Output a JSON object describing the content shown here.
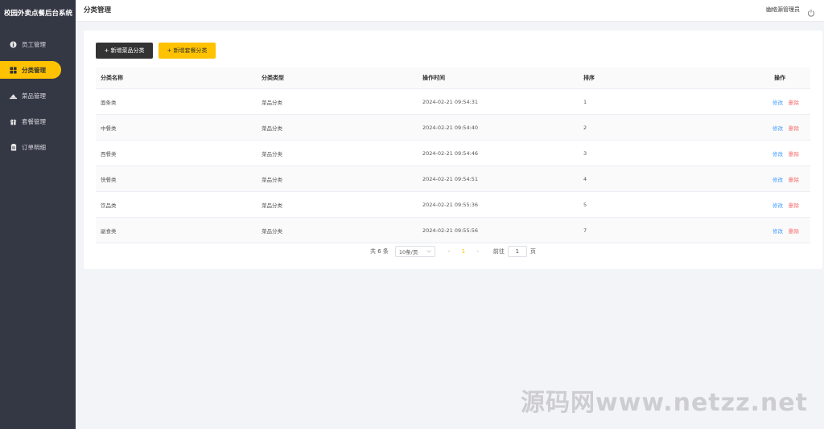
{
  "sidebar": {
    "title": "校园外卖点餐后台系统",
    "items": [
      {
        "label": "员工管理",
        "icon": "info-circle-icon"
      },
      {
        "label": "分类管理",
        "icon": "grid-icon"
      },
      {
        "label": "菜品管理",
        "icon": "dish-icon"
      },
      {
        "label": "套餐管理",
        "icon": "gift-icon"
      },
      {
        "label": "订单明细",
        "icon": "clipboard-icon"
      }
    ],
    "active_index": 1
  },
  "header": {
    "title": "分类管理",
    "user": "幽络源管理员",
    "logout_icon": "power-icon"
  },
  "toolbar": {
    "add_dish_category": "+ 新增菜品分类",
    "add_combo_category": "+ 新增套餐分类"
  },
  "table": {
    "columns": [
      "分类名称",
      "分类类型",
      "操作时间",
      "排序",
      "操作"
    ],
    "rows": [
      {
        "name": "面条类",
        "type": "菜品分类",
        "time": "2024-02-21 09:54:31",
        "sort": "1"
      },
      {
        "name": "中餐类",
        "type": "菜品分类",
        "time": "2024-02-21 09:54:40",
        "sort": "2"
      },
      {
        "name": "西餐类",
        "type": "菜品分类",
        "time": "2024-02-21 09:54:46",
        "sort": "3"
      },
      {
        "name": "快餐类",
        "type": "菜品分类",
        "time": "2024-02-21 09:54:51",
        "sort": "4"
      },
      {
        "name": "饮品类",
        "type": "菜品分类",
        "time": "2024-02-21 09:55:36",
        "sort": "5"
      },
      {
        "name": "副食类",
        "type": "菜品分类",
        "time": "2024-02-21 09:55:56",
        "sort": "7"
      }
    ],
    "edit_label": "修改",
    "delete_label": "删除"
  },
  "pagination": {
    "total": "共 6 条",
    "page_size": "10条/页",
    "current_page": "1",
    "goto_label": "前往",
    "goto_value": "1",
    "page_suffix": "页"
  },
  "watermark": "源码网www.netzz.net",
  "colors": {
    "sidebar_bg": "#343744",
    "accent": "#ffc200",
    "edit_link": "#419eff",
    "delete_link": "#f56c6c"
  }
}
